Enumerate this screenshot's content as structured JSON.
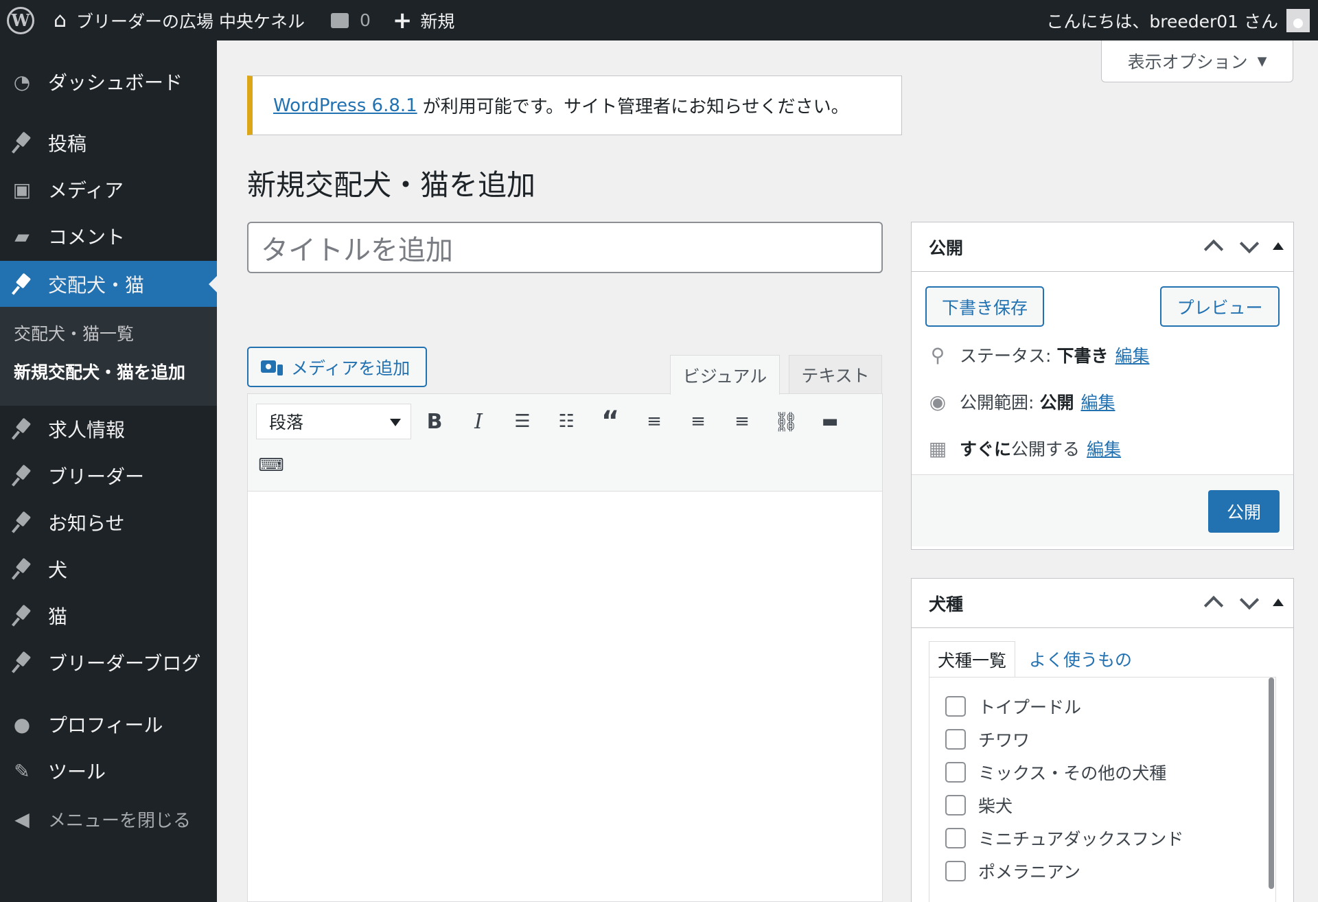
{
  "adminbar": {
    "site_name": "ブリーダーの広場 中央ケネル",
    "comments_count": "0",
    "new_label": "新規",
    "greeting": "こんにちは、breeder01 さん"
  },
  "sidebar": {
    "items": [
      {
        "label": "ダッシュボード",
        "icon": "dashboard-icon"
      },
      {
        "label": "投稿",
        "icon": "pin-icon"
      },
      {
        "label": "メディア",
        "icon": "media-icon"
      },
      {
        "label": "コメント",
        "icon": "comment-icon"
      },
      {
        "label": "交配犬・猫",
        "icon": "pin-icon"
      },
      {
        "label": "求人情報",
        "icon": "pin-icon"
      },
      {
        "label": "ブリーダー",
        "icon": "pin-icon"
      },
      {
        "label": "お知らせ",
        "icon": "pin-icon"
      },
      {
        "label": "犬",
        "icon": "pin-icon"
      },
      {
        "label": "猫",
        "icon": "pin-icon"
      },
      {
        "label": "ブリーダーブログ",
        "icon": "pin-icon"
      },
      {
        "label": "プロフィール",
        "icon": "user-icon"
      },
      {
        "label": "ツール",
        "icon": "wrench-icon"
      }
    ],
    "submenu": [
      "交配犬・猫一覧",
      "新規交配犬・猫を追加"
    ],
    "collapse_label": "メニューを閉じる"
  },
  "screen_options": "表示オプション",
  "notice": {
    "link": "WordPress 6.8.1",
    "text": "が利用可能です。サイト管理者にお知らせください。"
  },
  "page_title": "新規交配犬・猫を追加",
  "title_placeholder": "タイトルを追加",
  "editor": {
    "add_media": "メディアを追加",
    "tab_visual": "ビジュアル",
    "tab_text": "テキスト",
    "format": "段落"
  },
  "publish_box": {
    "title": "公開",
    "save_draft": "下書き保存",
    "preview": "プレビュー",
    "status_label": "ステータス:",
    "status_value": "下書き",
    "visibility_label": "公開範囲:",
    "visibility_value": "公開",
    "schedule_bold": "すぐに",
    "schedule_text": "公開する",
    "edit": "編集",
    "publish": "公開"
  },
  "breed_box": {
    "title": "犬種",
    "tab_all": "犬種一覧",
    "tab_popular": "よく使うもの",
    "items": [
      "トイプードル",
      "チワワ",
      "ミックス・その他の犬種",
      "柴犬",
      "ミニチュアダックスフンド",
      "ポメラニアン"
    ]
  }
}
